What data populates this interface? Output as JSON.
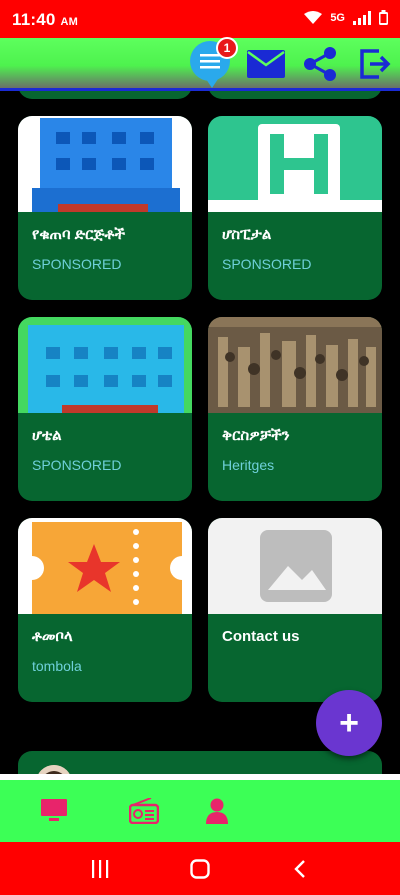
{
  "status_bar": {
    "time": "11:40",
    "ampm": "AM",
    "network": "5G"
  },
  "header": {
    "notification_count": "1"
  },
  "cards": [
    {
      "title": "የቁጠባ ድርጅቶች",
      "subtitle": "SPONSORED"
    },
    {
      "title": "ሆስፒታል",
      "subtitle": "SPONSORED"
    },
    {
      "title": "ሆቴል",
      "subtitle": "SPONSORED"
    },
    {
      "title": "ቅርስዎቻችን",
      "subtitle": "Heritges"
    },
    {
      "title": "ቶመቦላ",
      "subtitle": "tombola"
    },
    {
      "title": "Contact us",
      "subtitle": ""
    }
  ],
  "fab": {
    "label": "+"
  },
  "colors": {
    "status_bar": "#ff0000",
    "app_bar": "#4ef24e",
    "card": "#076630",
    "subtitle": "#6fd0d9",
    "fab": "#6a36d0",
    "bottom_nav": "#3cff56",
    "nav_icon": "#e8246b"
  },
  "icons": {
    "header": [
      "menu-icon",
      "mail-icon",
      "share-icon",
      "logout-icon"
    ],
    "bottom_nav": [
      "tv-icon",
      "radio-icon",
      "person-icon"
    ],
    "system_nav": [
      "recent-apps-icon",
      "home-icon",
      "back-icon"
    ]
  }
}
